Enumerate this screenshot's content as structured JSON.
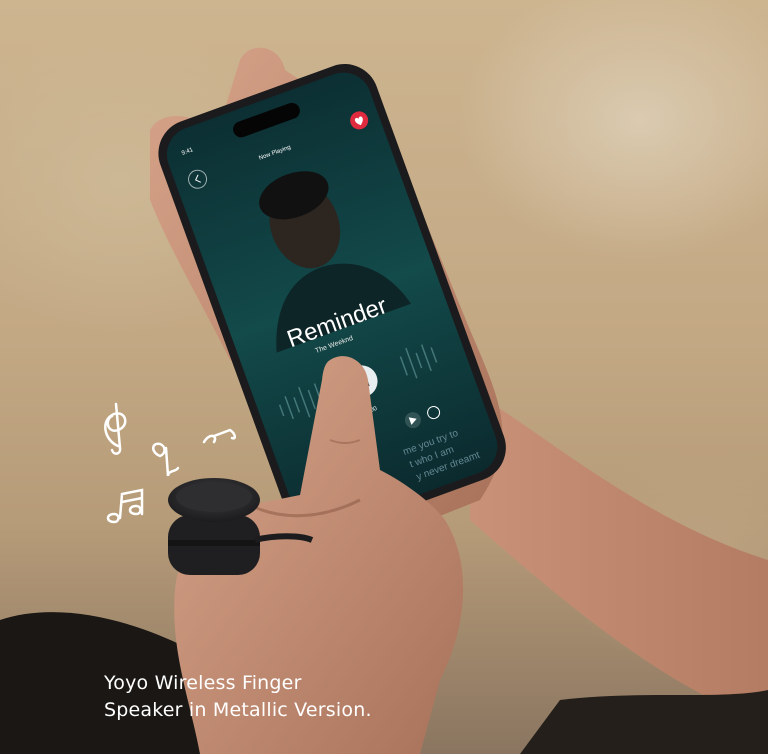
{
  "phone": {
    "status_time": "9:41",
    "header_title": "Now Playing",
    "song_title": "Reminder",
    "artist": "The Weeknd",
    "time_label": "0:00:00",
    "lyrics": [
      "me you try to",
      "t who I am",
      "y never dreamt"
    ]
  },
  "caption": {
    "line1": "Yoyo Wireless Finger",
    "line2": "Speaker in Metallic Version."
  },
  "colors": {
    "background": "#c9b291",
    "phone_screen": "#0f3b3c",
    "speaker": "#2a2a2c",
    "notes": "#ffffff"
  },
  "icons": [
    "heart-icon",
    "back-icon",
    "pause-icon",
    "play-icon",
    "repeat-icon",
    "music-notes-icon"
  ]
}
